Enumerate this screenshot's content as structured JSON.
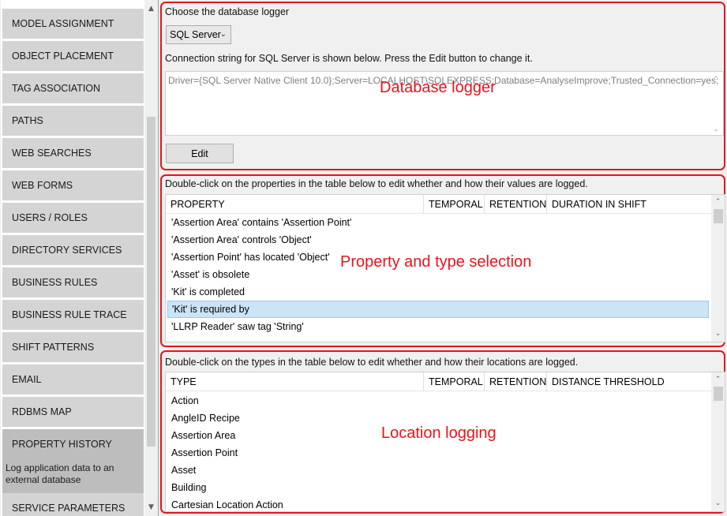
{
  "sidebar": {
    "items": [
      {
        "label": "MODEL ASSIGNMENT"
      },
      {
        "label": "OBJECT PLACEMENT"
      },
      {
        "label": "TAG ASSOCIATION"
      },
      {
        "label": "PATHS"
      },
      {
        "label": "WEB SEARCHES"
      },
      {
        "label": "WEB FORMS"
      },
      {
        "label": "USERS / ROLES"
      },
      {
        "label": "DIRECTORY SERVICES"
      },
      {
        "label": "BUSINESS RULES"
      },
      {
        "label": "BUSINESS RULE TRACE"
      },
      {
        "label": "SHIFT PATTERNS"
      },
      {
        "label": "EMAIL"
      },
      {
        "label": "RDBMS MAP"
      }
    ],
    "active": {
      "label": "PROPERTY HISTORY",
      "description": "Log application data to an external database"
    },
    "after": {
      "label": "SERVICE PARAMETERS"
    }
  },
  "logger": {
    "choose_label": "Choose the database logger",
    "selected_logger": "SQL Server",
    "connection_info": "Connection string for SQL Server is shown below. Press the Edit button to change it.",
    "connection_string": "Driver={SQL Server Native Client 10.0};Server=LOCALHOST\\SQLEXPRESS;Database=AnalyseImprove;Trusted_Connection=yes;",
    "edit_label": "Edit",
    "annotation": "Database  logger"
  },
  "properties": {
    "instructions": "Double-click on the properties in the table below to edit whether and how their values are logged.",
    "columns": [
      "PROPERTY",
      "TEMPORAL",
      "RETENTION",
      "DURATION IN SHIFT"
    ],
    "rows": [
      "'Assertion Area' contains 'Assertion Point'",
      "'Assertion Area' controls 'Object'",
      "'Assertion Point' has located 'Object'",
      "'Asset' is obsolete",
      "'Kit' is completed",
      "'Kit' is required by",
      "'LLRP Reader' saw tag 'String'"
    ],
    "selected_row": "'Kit' is required by",
    "annotation": "Property and type selection"
  },
  "locations": {
    "instructions": "Double-click on the types in the table below to edit whether and how their locations are logged.",
    "columns": [
      "TYPE",
      "TEMPORAL",
      "RETENTION",
      "DISTANCE THRESHOLD"
    ],
    "rows": [
      "Action",
      "AngleID Recipe",
      "Assertion Area",
      "Assertion Point",
      "Asset",
      "Building",
      "Cartesian Location Action"
    ],
    "annotation": "Location logging"
  },
  "colors": {
    "annotation": "#e8141b",
    "selection": "#cce4f7",
    "sidebar_item": "#d4d4d4",
    "sidebar_active": "#bdbdbd"
  }
}
